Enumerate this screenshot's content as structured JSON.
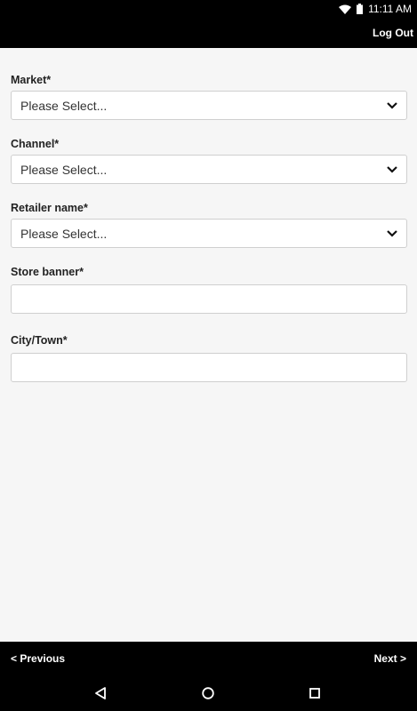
{
  "status_bar": {
    "time": "11:11 AM",
    "icons": [
      "wifi-icon",
      "battery-icon"
    ]
  },
  "header": {
    "logout_label": "Log Out"
  },
  "form": {
    "market": {
      "label": "Market*",
      "value": "Please Select..."
    },
    "channel": {
      "label": "Channel*",
      "value": "Please Select..."
    },
    "retailer": {
      "label": "Retailer name*",
      "value": "Please Select..."
    },
    "store_banner": {
      "label": "Store banner*",
      "value": ""
    },
    "city": {
      "label": "City/Town*",
      "value": ""
    }
  },
  "footer": {
    "previous_label": "< Previous",
    "next_label": "Next >"
  },
  "system_nav": {
    "icons": [
      "back-icon",
      "home-icon",
      "recents-icon"
    ]
  },
  "colors": {
    "bar_background": "#000000",
    "page_background": "#f6f6f6",
    "field_border": "#cfcfcf"
  }
}
